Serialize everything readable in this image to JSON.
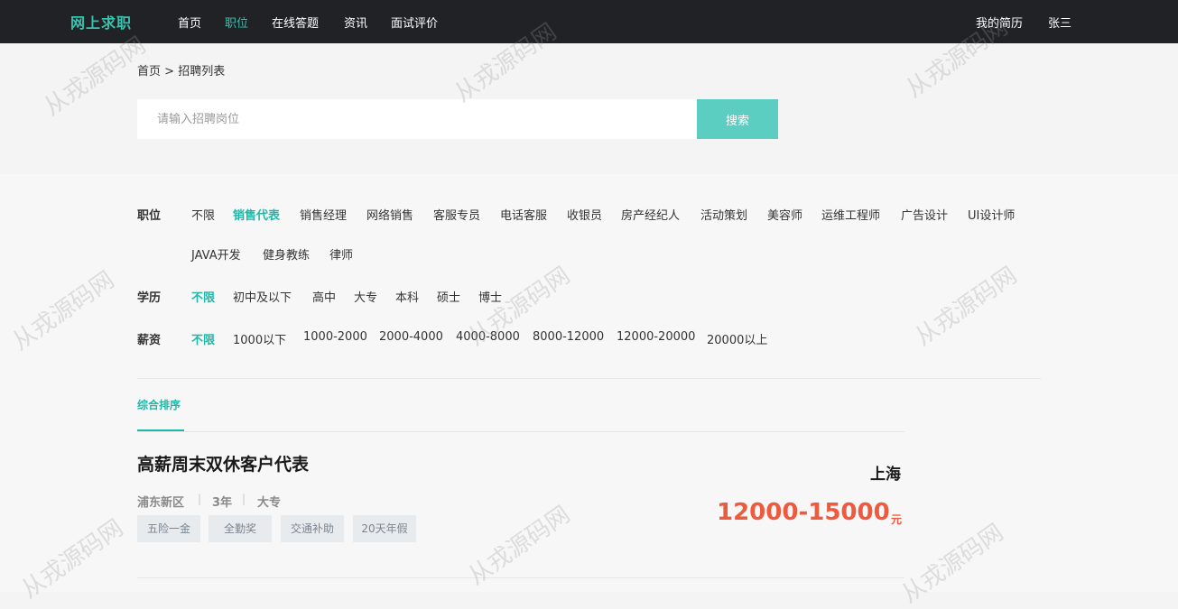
{
  "header": {
    "logo": "网上求职",
    "nav": [
      {
        "label": "首页"
      },
      {
        "label": "职位",
        "active": true
      },
      {
        "label": "在线答题"
      },
      {
        "label": "资讯"
      },
      {
        "label": "面试评价"
      }
    ],
    "my_resume": "我的简历",
    "username": "张三"
  },
  "breadcrumb": {
    "home": "首页",
    "sep": ">",
    "current": "招聘列表"
  },
  "search": {
    "placeholder": "请输入招聘岗位",
    "button": "搜索"
  },
  "filters": {
    "position": {
      "label": "职位",
      "options": [
        "不限",
        "销售代表",
        "销售经理",
        "网络销售",
        "客服专员",
        "电话客服",
        "收银员",
        "房产经纪人",
        "活动策划",
        "美容师",
        "运维工程师",
        "广告设计",
        "UI设计师",
        "JAVA开发",
        "健身教练",
        "律师"
      ],
      "selected": "销售代表"
    },
    "education": {
      "label": "学历",
      "options": [
        "不限",
        "初中及以下",
        "高中",
        "大专",
        "本科",
        "硕士",
        "博士"
      ],
      "selected": "不限"
    },
    "salary": {
      "label": "薪资",
      "options": [
        "不限",
        "1000以下",
        "1000-2000",
        "2000-4000",
        "4000-8000",
        "8000-12000",
        "12000-20000",
        "20000以上"
      ],
      "selected": "不限"
    }
  },
  "sort": {
    "label": "综合排序"
  },
  "jobs": [
    {
      "title": "高薪周末双休客户代表",
      "district": "浦东新区",
      "experience": "3年",
      "education": "大专",
      "tags": [
        "五险一金",
        "全勤奖",
        "交通补助",
        "20天年假"
      ],
      "city": "上海",
      "salary": "12000-15000",
      "salary_unit": "元"
    }
  ],
  "watermark": "从戎源码网",
  "colors": {
    "accent": "#1fb8a8",
    "header_bg": "#202226",
    "salary": "#ee5a3e",
    "search_button": "#5bcdc1"
  }
}
